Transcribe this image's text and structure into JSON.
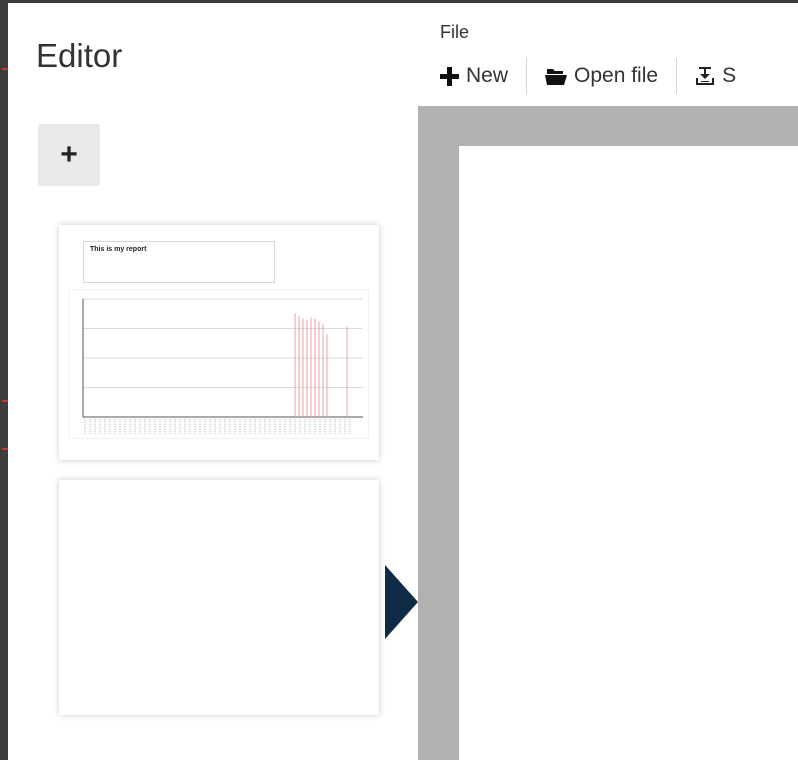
{
  "app": {
    "title": "Editor"
  },
  "sidebar": {
    "add_page": {
      "label": "+",
      "icon": "plus-icon"
    },
    "thumbnails": [
      {
        "text": "This is my report",
        "chart": {
          "type": "bar",
          "bar_color": "#e8a0a0",
          "grid": true,
          "bar_heights": [
            0.98,
            0.95,
            0.93,
            0.92,
            0.94,
            0.93,
            0.9,
            0.88,
            0.78,
            0.0,
            0.0,
            0.0,
            0.0,
            0.85
          ]
        }
      },
      {
        "text": ""
      }
    ]
  },
  "menu": {
    "file": "File"
  },
  "toolbar": {
    "new": {
      "label": "New",
      "icon": "plus-icon"
    },
    "open": {
      "label": "Open file",
      "icon": "folder-open-icon"
    },
    "save": {
      "label": "S",
      "icon": "save-download-icon"
    }
  },
  "colors": {
    "accent": "#0f2b45",
    "canvas_bg": "#b1b1b1",
    "button_bg": "#e9e9e9"
  }
}
